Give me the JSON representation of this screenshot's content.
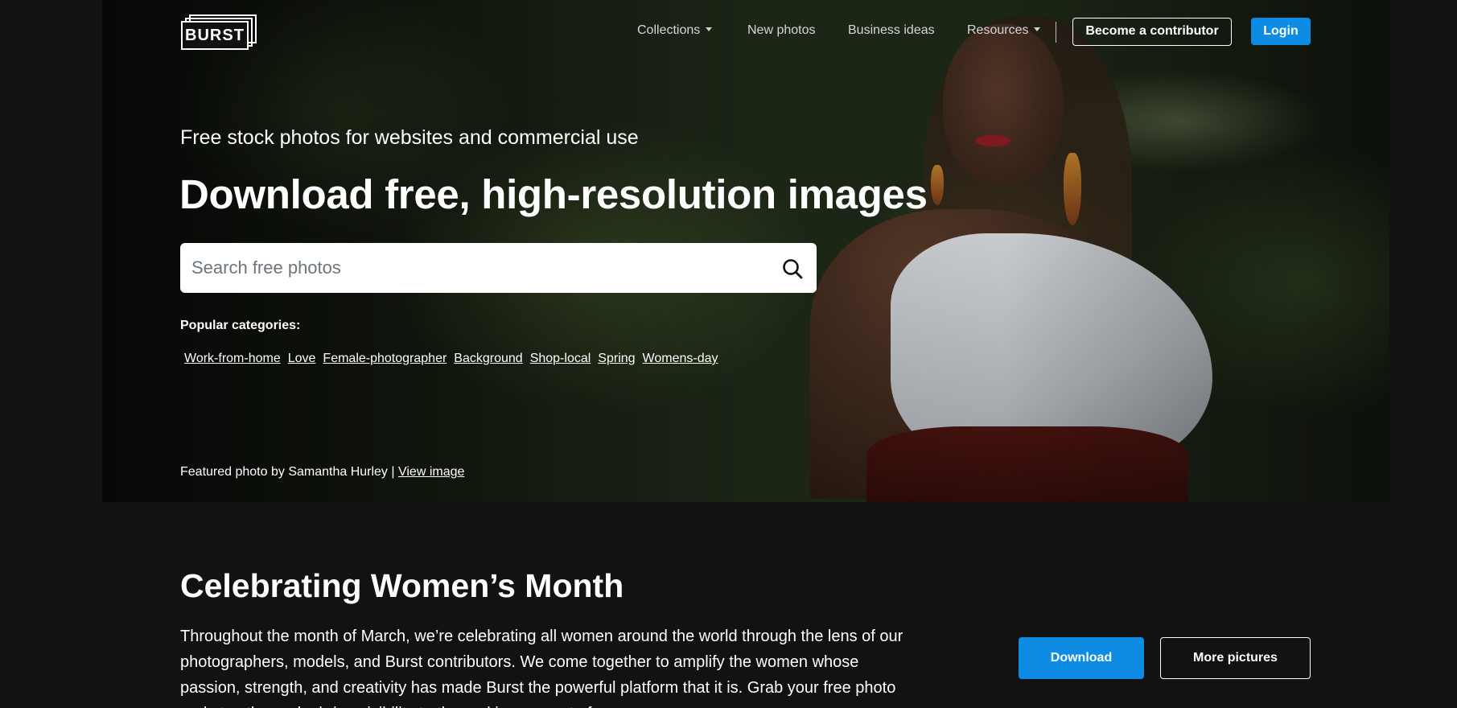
{
  "nav": {
    "logo_text": "BURST",
    "links": [
      {
        "label": "Collections",
        "has_dropdown": true
      },
      {
        "label": "New photos",
        "has_dropdown": false
      },
      {
        "label": "Business ideas",
        "has_dropdown": false
      },
      {
        "label": "Resources",
        "has_dropdown": true
      }
    ],
    "contributor_label": "Become a contributor",
    "login_label": "Login"
  },
  "hero": {
    "subtitle": "Free stock photos for websites and commercial use",
    "headline": "Download free, high-resolution images",
    "search": {
      "placeholder": "Search free photos",
      "value": "",
      "icon": "search-icon"
    },
    "popular_label": "Popular categories:",
    "categories": [
      "Work-from-home",
      "Love",
      "Female-photographer",
      "Background",
      "Shop-local",
      "Spring",
      "Womens-day"
    ],
    "featured_prefix": "Featured photo by Samantha Hurley | ",
    "featured_link": "View image"
  },
  "section": {
    "title": "Celebrating Women’s Month",
    "body": "Throughout the month of March, we’re celebrating all women around the world through the lens of our photographers, models, and Burst contributors. We come together to amplify the women whose passion, strength, and creativity has made Burst the powerful platform that it is. Grab your free photo and stop the cycle: bring visibility to the real images out of women.",
    "download_label": "Download",
    "more_label": "More pictures"
  },
  "colors": {
    "accent": "#0e8ce4",
    "background": "#121212",
    "text": "#ffffff"
  }
}
